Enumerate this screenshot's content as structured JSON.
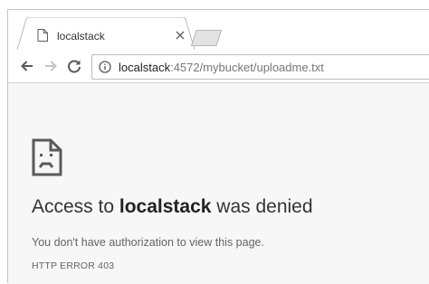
{
  "tab": {
    "title": "localstack",
    "favicon": "page-icon",
    "close_icon": "close-icon"
  },
  "toolbar": {
    "back_icon": "back-arrow-icon",
    "forward_icon": "forward-arrow-icon",
    "reload_icon": "reload-icon"
  },
  "omnibox": {
    "info_icon": "info-icon",
    "url_host": "localstack",
    "url_rest": ":4572/mybucket/uploadme.txt"
  },
  "error": {
    "icon": "sad-page-icon",
    "title_prefix": "Access to ",
    "title_host": "localstack",
    "title_suffix": " was denied",
    "description": "You don't have authorization to view this page.",
    "code": "HTTP ERROR 403"
  },
  "colors": {
    "content_background": "#f7f7f7",
    "text_primary": "#333333",
    "text_secondary": "#646464"
  }
}
